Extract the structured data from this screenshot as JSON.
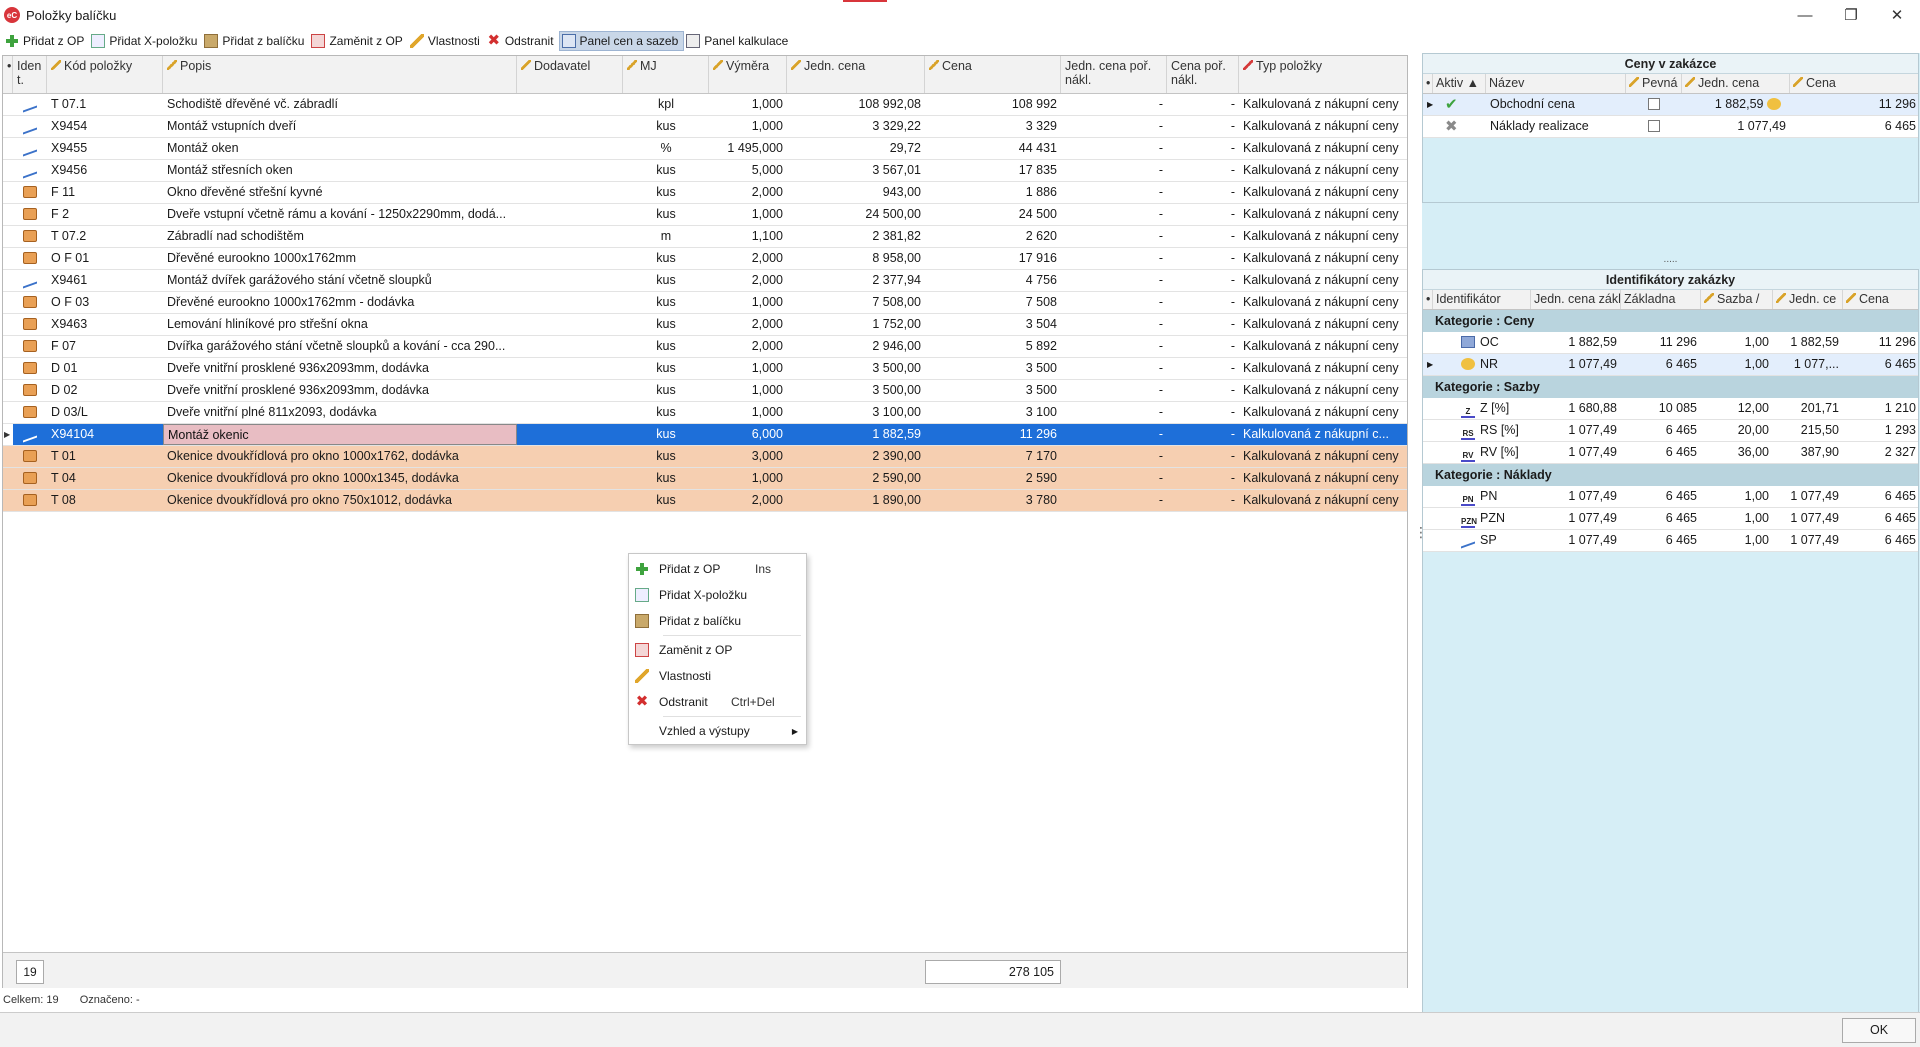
{
  "window": {
    "title": "Položky balíčku",
    "logo": "eC",
    "controls": {
      "minimize": "—",
      "restore": "❐",
      "close": "✕"
    }
  },
  "toolbar": [
    {
      "label": "Přidat z OP",
      "icon": "plus-icon"
    },
    {
      "label": "Přidat X-položku",
      "icon": "x-item-icon"
    },
    {
      "label": "Přidat z balíčku",
      "icon": "package-icon"
    },
    {
      "label": "Zaměnit z OP",
      "icon": "swap-icon"
    },
    {
      "label": "Vlastnosti",
      "icon": "pencil-icon"
    },
    {
      "label": "Odstranit",
      "icon": "delete-icon"
    },
    {
      "label": "Panel cen a sazeb",
      "icon": "panel-icon",
      "active": true
    },
    {
      "label": "Panel kalkulace",
      "icon": "panel-calc-icon"
    }
  ],
  "grid": {
    "columns": {
      "ident": "Iden t.",
      "kod": "Kód položky",
      "popis": "Popis",
      "dodavatel": "Dodavatel",
      "mj": "MJ",
      "vymera": "Výměra",
      "jedn_cena": "Jedn. cena",
      "cena": "Cena",
      "jedn_cena_por": "Jedn. cena poř. nákl.",
      "cena_por": "Cena poř. nákl.",
      "typ": "Typ položky"
    },
    "rows": [
      {
        "icon": "line",
        "kod": "T 07.1",
        "popis": "Schodiště dřevěné vč. zábradlí",
        "mj": "kpl",
        "vymera": "1,000",
        "jedn_cena": "108 992,08",
        "cena": "108 992",
        "jpn": "-",
        "cpn": "-",
        "typ": "Kalkulovaná z nákupní ceny"
      },
      {
        "icon": "line",
        "kod": "X9454",
        "popis": "Montáž vstupních dveří",
        "mj": "kus",
        "vymera": "1,000",
        "jedn_cena": "3 329,22",
        "cena": "3 329",
        "jpn": "-",
        "cpn": "-",
        "typ": "Kalkulovaná z nákupní ceny"
      },
      {
        "icon": "line",
        "kod": "X9455",
        "popis": "Montáž oken",
        "mj": "%",
        "vymera": "1 495,000",
        "jedn_cena": "29,72",
        "cena": "44 431",
        "jpn": "-",
        "cpn": "-",
        "typ": "Kalkulovaná z nákupní ceny"
      },
      {
        "icon": "line",
        "kod": "X9456",
        "popis": "Montáž střesních oken",
        "mj": "kus",
        "vymera": "5,000",
        "jedn_cena": "3 567,01",
        "cena": "17 835",
        "jpn": "-",
        "cpn": "-",
        "typ": "Kalkulovaná z nákupní ceny"
      },
      {
        "icon": "box",
        "kod": "F 11",
        "popis": "Okno dřevěné střešní kyvné",
        "mj": "kus",
        "vymera": "2,000",
        "jedn_cena": "943,00",
        "cena": "1 886",
        "jpn": "-",
        "cpn": "-",
        "typ": "Kalkulovaná z nákupní ceny"
      },
      {
        "icon": "box",
        "kod": "F 2",
        "popis": "Dveře vstupní včetně rámu a kování - 1250x2290mm, dodá...",
        "mj": "kus",
        "vymera": "1,000",
        "jedn_cena": "24 500,00",
        "cena": "24 500",
        "jpn": "-",
        "cpn": "-",
        "typ": "Kalkulovaná z nákupní ceny"
      },
      {
        "icon": "box",
        "kod": "T 07.2",
        "popis": "Zábradlí nad schodištěm",
        "mj": "m",
        "vymera": "1,100",
        "jedn_cena": "2 381,82",
        "cena": "2 620",
        "jpn": "-",
        "cpn": "-",
        "typ": "Kalkulovaná z nákupní ceny"
      },
      {
        "icon": "box",
        "kod": "O F 01",
        "popis": "Dřevěné eurookno 1000x1762mm",
        "mj": "kus",
        "vymera": "2,000",
        "jedn_cena": "8 958,00",
        "cena": "17 916",
        "jpn": "-",
        "cpn": "-",
        "typ": "Kalkulovaná z nákupní ceny"
      },
      {
        "icon": "line",
        "kod": "X9461",
        "popis": "Montáž dvířek garážového stání včetně sloupků",
        "mj": "kus",
        "vymera": "2,000",
        "jedn_cena": "2 377,94",
        "cena": "4 756",
        "jpn": "-",
        "cpn": "-",
        "typ": "Kalkulovaná z nákupní ceny"
      },
      {
        "icon": "box",
        "kod": "O F 03",
        "popis": "Dřevěné eurookno 1000x1762mm - dodávka",
        "mj": "kus",
        "vymera": "1,000",
        "jedn_cena": "7 508,00",
        "cena": "7 508",
        "jpn": "-",
        "cpn": "-",
        "typ": "Kalkulovaná z nákupní ceny"
      },
      {
        "icon": "box",
        "kod": "X9463",
        "popis": "Lemování hliníkové pro střešní okna",
        "mj": "kus",
        "vymera": "2,000",
        "jedn_cena": "1 752,00",
        "cena": "3 504",
        "jpn": "-",
        "cpn": "-",
        "typ": "Kalkulovaná z nákupní ceny"
      },
      {
        "icon": "box",
        "kod": "F 07",
        "popis": "Dvířka garážového stání včetně sloupků a kování - cca 290...",
        "mj": "kus",
        "vymera": "2,000",
        "jedn_cena": "2 946,00",
        "cena": "5 892",
        "jpn": "-",
        "cpn": "-",
        "typ": "Kalkulovaná z nákupní ceny"
      },
      {
        "icon": "box",
        "kod": "D 01",
        "popis": "Dveře vnitřní prosklené 936x2093mm, dodávka",
        "mj": "kus",
        "vymera": "1,000",
        "jedn_cena": "3 500,00",
        "cena": "3 500",
        "jpn": "-",
        "cpn": "-",
        "typ": "Kalkulovaná z nákupní ceny"
      },
      {
        "icon": "box",
        "kod": "D 02",
        "popis": "Dveře vnitřní prosklené 936x2093mm, dodávka",
        "mj": "kus",
        "vymera": "1,000",
        "jedn_cena": "3 500,00",
        "cena": "3 500",
        "jpn": "-",
        "cpn": "-",
        "typ": "Kalkulovaná z nákupní ceny"
      },
      {
        "icon": "box",
        "kod": "D 03/L",
        "popis": "Dveře vnitřní plné 811x2093, dodávka",
        "mj": "kus",
        "vymera": "1,000",
        "jedn_cena": "3 100,00",
        "cena": "3 100",
        "jpn": "-",
        "cpn": "-",
        "typ": "Kalkulovaná z nákupní ceny"
      },
      {
        "icon": "line",
        "kod": "X94104",
        "popis": "Montáž okenic",
        "mj": "kus",
        "vymera": "6,000",
        "jedn_cena": "1 882,59",
        "cena": "11 296",
        "jpn": "-",
        "cpn": "-",
        "typ": "Kalkulovaná z nákupní c...",
        "selected": true
      },
      {
        "icon": "box",
        "kod": "T 01",
        "popis": "Okenice dvoukřídlová pro okno 1000x1762, dodávka",
        "mj": "kus",
        "vymera": "3,000",
        "jedn_cena": "2 390,00",
        "cena": "7 170",
        "jpn": "-",
        "cpn": "-",
        "typ": "Kalkulovaná z nákupní ceny",
        "highlight": true
      },
      {
        "icon": "box",
        "kod": "T 04",
        "popis": "Okenice dvoukřídlová pro okno 1000x1345, dodávka",
        "mj": "kus",
        "vymera": "1,000",
        "jedn_cena": "2 590,00",
        "cena": "2 590",
        "jpn": "-",
        "cpn": "-",
        "typ": "Kalkulovaná z nákupní ceny",
        "highlight": true
      },
      {
        "icon": "box",
        "kod": "T 08",
        "popis": "Okenice dvoukřídlová pro okno 750x1012, dodávka",
        "mj": "kus",
        "vymera": "2,000",
        "jedn_cena": "1 890,00",
        "cena": "3 780",
        "jpn": "-",
        "cpn": "-",
        "typ": "Kalkulovaná z nákupní ceny",
        "highlight": true
      }
    ],
    "footer": {
      "count": "19",
      "sum": "278 105"
    }
  },
  "status": {
    "celkem": "Celkem: 19",
    "oznaceno": "Označeno: -"
  },
  "context_menu": {
    "items": [
      {
        "label": "Přidat z OP",
        "shortcut": "Ins",
        "icon": "plus-icon"
      },
      {
        "label": "Přidat X-položku",
        "shortcut": "",
        "icon": "x-item-icon"
      },
      {
        "label": "Přidat z balíčku",
        "shortcut": "",
        "icon": "package-icon"
      },
      {
        "label": "Zaměnit z OP",
        "shortcut": "",
        "icon": "swap-icon"
      },
      {
        "label": "Vlastnosti",
        "shortcut": "",
        "icon": "pencil-icon"
      },
      {
        "label": "Odstranit",
        "shortcut": "Ctrl+Del",
        "icon": "delete-icon"
      },
      {
        "label": "Vzhled a výstupy",
        "shortcut": "",
        "icon": "submenu-arrow"
      }
    ]
  },
  "prices_panel": {
    "title": "Ceny v zakázce",
    "columns": {
      "aktiv": "Aktiv",
      "nazev": "Název",
      "pevna": "Pevná",
      "jedn_cena": "Jedn. cena",
      "cena": "Cena"
    },
    "rows": [
      {
        "nazev": "Obchodní cena",
        "jedn_cena": "1 882,59",
        "cena": "11 296",
        "status_icon": "check-icon"
      },
      {
        "nazev": "Náklady realizace",
        "jedn_cena": "1 077,49",
        "cena": "6 465",
        "status_icon": "inactive-icon"
      }
    ]
  },
  "ident_panel": {
    "title": "Identifikátory zakázky",
    "columns": {
      "identifikator": "Identifikátor",
      "jedn_cena_zakl": "Jedn. cena zákl",
      "zakladna": "Základna",
      "sazba": "Sazba /",
      "jedn_ce": "Jedn. ce",
      "cena": "Cena"
    },
    "categories": [
      {
        "label": "Kategorie : Ceny",
        "rows": [
          {
            "icon": "oc",
            "id": "OC",
            "jcz": "1 882,59",
            "zakl": "11 296",
            "sazba": "1,00",
            "jc": "1 882,59",
            "cena": "11 296"
          },
          {
            "icon": "coin",
            "id": "NR",
            "jcz": "1 077,49",
            "zakl": "6 465",
            "sazba": "1,00",
            "jc": "1 077,...",
            "cena": "6 465",
            "selected": true
          }
        ]
      },
      {
        "label": "Kategorie : Sazby",
        "rows": [
          {
            "icon": "Z",
            "id": "Z [%]",
            "jcz": "1 680,88",
            "zakl": "10 085",
            "sazba": "12,00",
            "jc": "201,71",
            "cena": "1 210"
          },
          {
            "icon": "RS",
            "id": "RS [%]",
            "jcz": "1 077,49",
            "zakl": "6 465",
            "sazba": "20,00",
            "jc": "215,50",
            "cena": "1 293"
          },
          {
            "icon": "RV",
            "id": "RV [%]",
            "jcz": "1 077,49",
            "zakl": "6 465",
            "sazba": "36,00",
            "jc": "387,90",
            "cena": "2 327"
          }
        ]
      },
      {
        "label": "Kategorie : Náklady",
        "rows": [
          {
            "icon": "PN",
            "id": "PN",
            "jcz": "1 077,49",
            "zakl": "6 465",
            "sazba": "1,00",
            "jc": "1 077,49",
            "cena": "6 465"
          },
          {
            "icon": "PZN",
            "id": "PZN",
            "jcz": "1 077,49",
            "zakl": "6 465",
            "sazba": "1,00",
            "jc": "1 077,49",
            "cena": "6 465"
          },
          {
            "icon": "ln",
            "id": "SP",
            "jcz": "1 077,49",
            "zakl": "6 465",
            "sazba": "1,00",
            "jc": "1 077,49",
            "cena": "6 465"
          }
        ]
      }
    ]
  },
  "buttons": {
    "ok": "OK"
  },
  "colors": {
    "selection": "#1e6fd9",
    "highlight_row": "#f6cfb1",
    "panel_bg": "#d6eef6",
    "category_bg": "#b9d4de"
  }
}
